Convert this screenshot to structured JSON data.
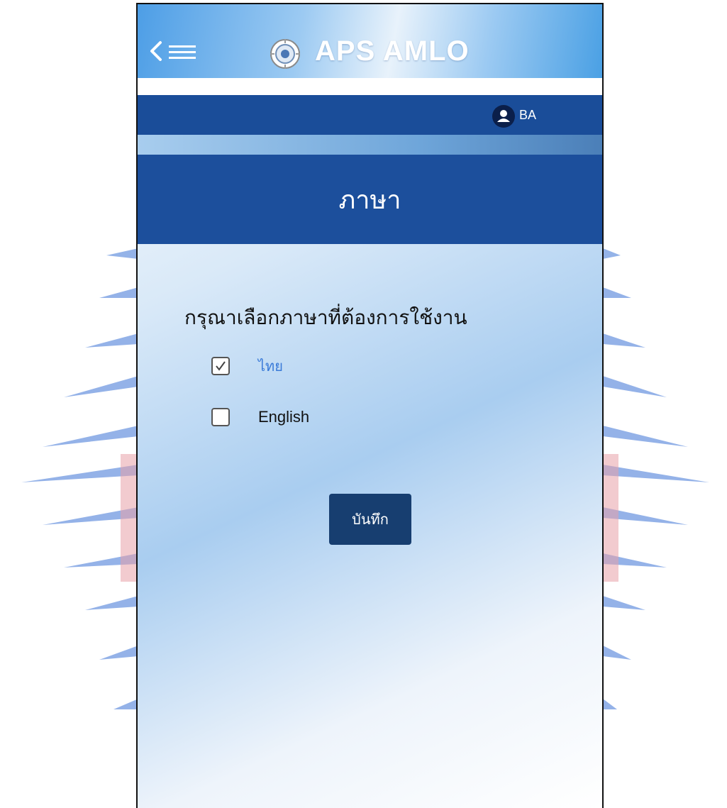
{
  "app": {
    "title": "APS AMLO"
  },
  "user": {
    "name": "BA"
  },
  "page": {
    "title": "ภาษา"
  },
  "language": {
    "prompt": "กรุณาเลือกภาษาที่ต้องการใช้งาน",
    "options": [
      {
        "label": "ไทย",
        "checked": true
      },
      {
        "label": "English",
        "checked": false
      }
    ]
  },
  "actions": {
    "save_label": "บันทึก"
  },
  "icons": {
    "back": "chevron-left-icon",
    "menu": "hamburger-menu-icon",
    "logo": "amlo-emblem-icon",
    "avatar": "user-avatar-icon",
    "check": "checkmark-icon"
  },
  "colors": {
    "header_band": "#1a4d99",
    "title_band": "#1c4f9c",
    "save_button": "#173e70",
    "selected_text": "#3b7bd8"
  }
}
